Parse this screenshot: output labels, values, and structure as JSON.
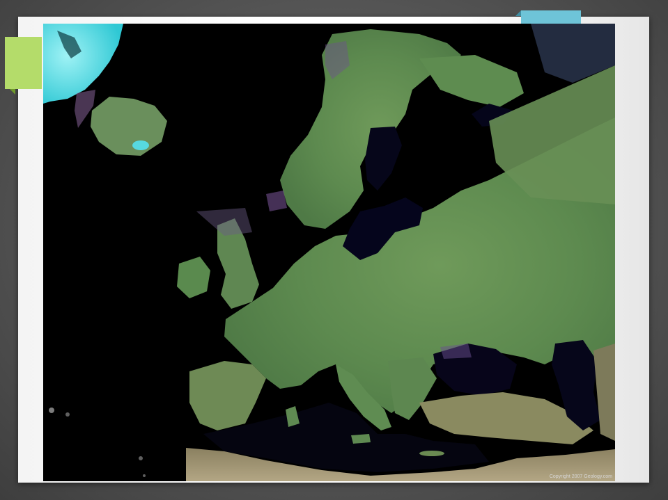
{
  "slide": {
    "accent_green_color": "#b4dc6a",
    "accent_blue_color": "#6ec4d8"
  },
  "map": {
    "description_icon": "satellite-map-europe",
    "land_color": "#5c8a4e",
    "sea_color": "#000000",
    "credit": "Copyright 2007 Geology.com"
  }
}
